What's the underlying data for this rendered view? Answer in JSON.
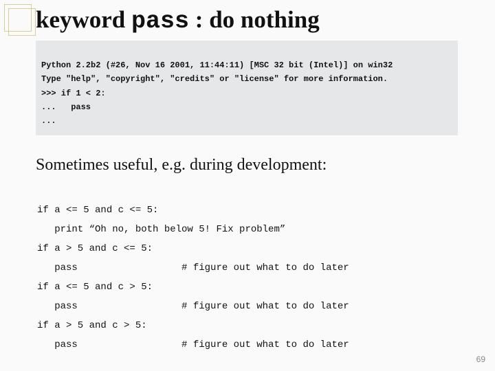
{
  "title": {
    "pre": "keyword ",
    "mono": "pass",
    "post": " : do nothing"
  },
  "console": {
    "l0": "Python 2.2b2 (#26, Nov 16 2001, 11:44:11) [MSC 32 bit (Intel)] on win32",
    "l1": "Type \"help\", \"copyright\", \"credits\" or \"license\" for more information.",
    "l2": ">>> if 1 < 2:",
    "l3": "...   pass",
    "l4": "..."
  },
  "para": "Sometimes useful, e.g. during development:",
  "code": {
    "l0": "if a <= 5 and c <= 5:",
    "l1": "   print “Oh no, both below 5! Fix problem”",
    "l2": "if a > 5 and c <= 5:",
    "l3": "   pass                  # figure out what to do later",
    "l4": "if a <= 5 and c > 5:",
    "l5": "   pass                  # figure out what to do later",
    "l6": "if a > 5 and c > 5:",
    "l7": "   pass                  # figure out what to do later"
  },
  "pagenum": "69"
}
